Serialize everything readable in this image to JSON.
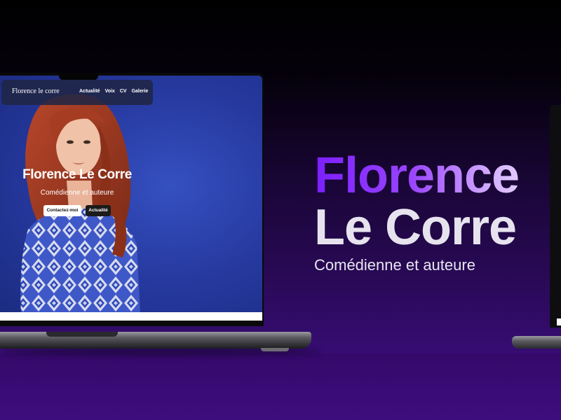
{
  "colors": {
    "background_top": "#000000",
    "background_bottom": "#3e0f80",
    "accent_purple": "#7b1fff",
    "hero_blue": "#22379c"
  },
  "laptop_site": {
    "brand": "Florence le corre",
    "nav_links": [
      "Actualité",
      "Voix",
      "CV",
      "Galerie"
    ],
    "hero_title": "Florence Le Corre",
    "hero_subtitle": "Comédienne et auteure",
    "primary_button": "Contactez-moi",
    "secondary_button": "Actualité"
  },
  "headline": {
    "first_name": "Florence",
    "last_name": "Le Corre",
    "subtitle": "Comédienne et auteure"
  },
  "icons": [
    "laptop-icon",
    "portrait-photo"
  ]
}
